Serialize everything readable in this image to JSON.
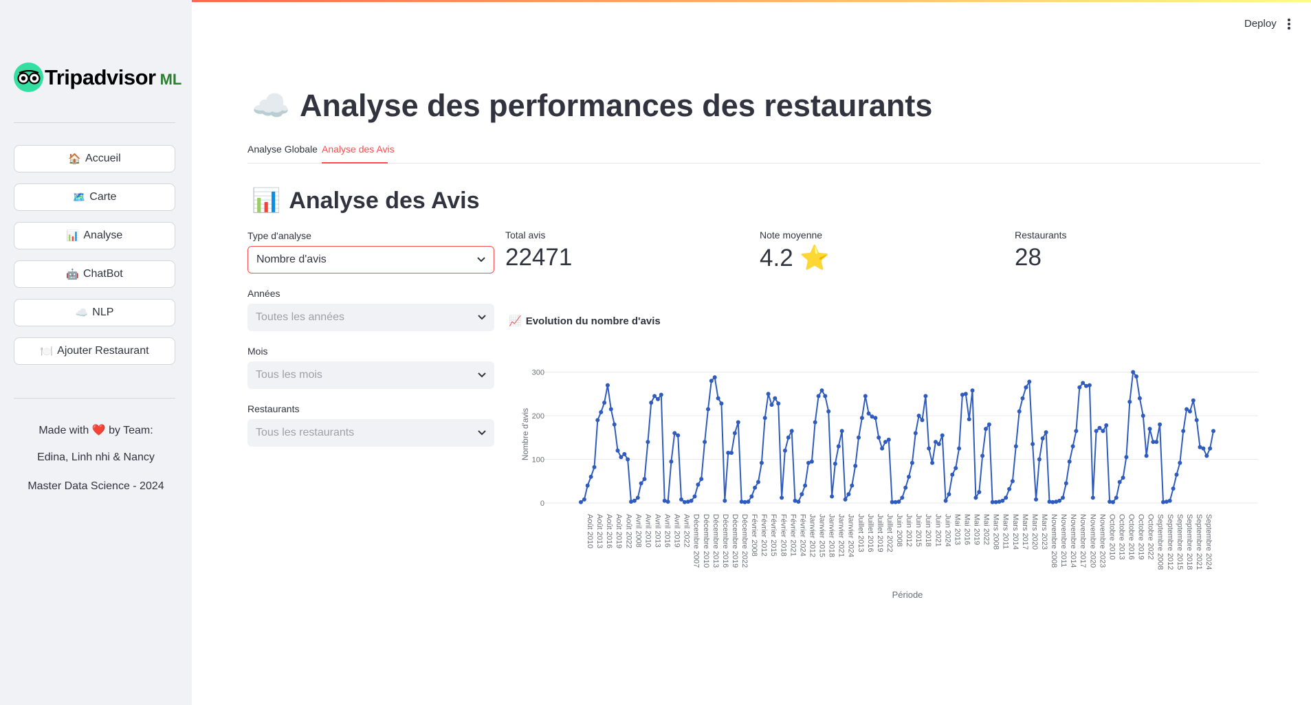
{
  "sidebar": {
    "logo_text": "Tripadvisor",
    "logo_suffix": "ML",
    "nav": [
      {
        "icon": "🏠",
        "label": "Accueil"
      },
      {
        "icon": "🗺️",
        "label": "Carte"
      },
      {
        "icon": "📊",
        "label": "Analyse"
      },
      {
        "icon": "🤖",
        "label": "ChatBot"
      },
      {
        "icon": "☁️",
        "label": "NLP"
      },
      {
        "icon": "🍽️",
        "label": "Ajouter Restaurant"
      }
    ],
    "footer": {
      "made_with": "Made with",
      "by_team": "by Team:",
      "team": "Edina, Linh nhi & Nancy",
      "course": "Master Data Science - 2024"
    }
  },
  "header": {
    "deploy_label": "Deploy"
  },
  "page": {
    "title": "Analyse des performances des restaurants",
    "title_icon": "☁️"
  },
  "tabs": [
    {
      "label": "Analyse Globale",
      "active": false
    },
    {
      "label": "Analyse des Avis",
      "active": true
    }
  ],
  "section": {
    "title": "Analyse des Avis",
    "icon": "📊"
  },
  "filters": {
    "type": {
      "label": "Type d'analyse",
      "value": "Nombre d'avis"
    },
    "years": {
      "label": "Années",
      "placeholder": "Toutes les années"
    },
    "months": {
      "label": "Mois",
      "placeholder": "Tous les mois"
    },
    "restaurants": {
      "label": "Restaurants",
      "placeholder": "Tous les restaurants"
    }
  },
  "metrics": [
    {
      "label": "Total avis",
      "value": "22471"
    },
    {
      "label": "Note moyenne",
      "value": "4.2 ⭐"
    },
    {
      "label": "Restaurants",
      "value": "28"
    }
  ],
  "chart_header": {
    "icon": "📈",
    "title": "Evolution du nombre d'avis"
  },
  "colors": {
    "accent": "#ff4b4b",
    "line": "#2e5bbd",
    "sidebar_bg": "#f0f2f6"
  },
  "chart_data": {
    "type": "line",
    "xlabel": "Période",
    "ylabel": "Nombre d'avis",
    "yticks": [
      0,
      100,
      200,
      300
    ],
    "ylim": [
      0,
      315
    ],
    "grid": true,
    "tick_labels": [
      "Août 2010",
      "Août 2013",
      "Août 2016",
      "Août 2019",
      "Août 2022",
      "Avril 2008",
      "Avril 2010",
      "Avril 2013",
      "Avril 2016",
      "Avril 2019",
      "Avril 2022",
      "Décembre 2007",
      "Décembre 2010",
      "Décembre 2013",
      "Décembre 2016",
      "Décembre 2019",
      "Décembre 2022",
      "Février 2008",
      "Février 2012",
      "Février 2015",
      "Février 2018",
      "Février 2021",
      "Février 2024",
      "Janvier 2012",
      "Janvier 2015",
      "Janvier 2018",
      "Janvier 2021",
      "Janvier 2024",
      "Juillet 2013",
      "Juillet 2016",
      "Juillet 2019",
      "Juillet 2022",
      "Juin 2008",
      "Juin 2012",
      "Juin 2015",
      "Juin 2018",
      "Juin 2021",
      "Juin 2024",
      "Mai 2013",
      "Mai 2016",
      "Mai 2019",
      "Mai 2022",
      "Mars 2008",
      "Mars 2011",
      "Mars 2014",
      "Mars 2017",
      "Mars 2020",
      "Mars 2023",
      "Novembre 2008",
      "Novembre 2011",
      "Novembre 2014",
      "Novembre 2017",
      "Novembre 2020",
      "Novembre 2023",
      "Octobre 2010",
      "Octobre 2013",
      "Octobre 2016",
      "Octobre 2019",
      "Octobre 2022",
      "Septembre 2008",
      "Septembre 2012",
      "Septembre 2015",
      "Septembre 2018",
      "Septembre 2021",
      "Septembre 2024"
    ],
    "values": [
      2,
      8,
      40,
      60,
      82,
      190,
      208,
      230,
      270,
      215,
      180,
      120,
      105,
      112,
      100,
      3,
      5,
      12,
      45,
      55,
      140,
      230,
      245,
      238,
      248,
      5,
      3,
      95,
      160,
      155,
      8,
      2,
      3,
      5,
      15,
      42,
      55,
      140,
      215,
      280,
      288,
      240,
      228,
      5,
      115,
      115,
      160,
      185,
      3,
      2,
      3,
      15,
      35,
      48,
      92,
      195,
      250,
      225,
      240,
      228,
      12,
      120,
      150,
      165,
      5,
      3,
      20,
      40,
      92,
      95,
      185,
      245,
      258,
      245,
      210,
      15,
      90,
      130,
      165,
      8,
      20,
      40,
      85,
      150,
      195,
      245,
      205,
      198,
      195,
      150,
      125,
      140,
      145,
      2,
      2,
      3,
      12,
      35,
      60,
      92,
      160,
      200,
      190,
      245,
      125,
      92,
      140,
      135,
      155,
      5,
      20,
      65,
      80,
      125,
      248,
      250,
      192,
      258,
      12,
      25,
      108,
      170,
      180,
      2,
      2,
      3,
      5,
      12,
      32,
      50,
      130,
      210,
      240,
      265,
      278,
      135,
      8,
      100,
      148,
      162,
      3,
      2,
      3,
      5,
      12,
      45,
      95,
      130,
      165,
      265,
      275,
      268,
      270,
      12,
      165,
      172,
      165,
      178,
      3,
      2,
      12,
      48,
      58,
      105,
      232,
      300,
      290,
      240,
      200,
      108,
      170,
      140,
      140,
      180,
      2,
      3,
      5,
      33,
      65,
      92,
      165,
      215,
      210,
      235,
      190,
      128,
      125,
      108,
      125,
      165
    ]
  }
}
